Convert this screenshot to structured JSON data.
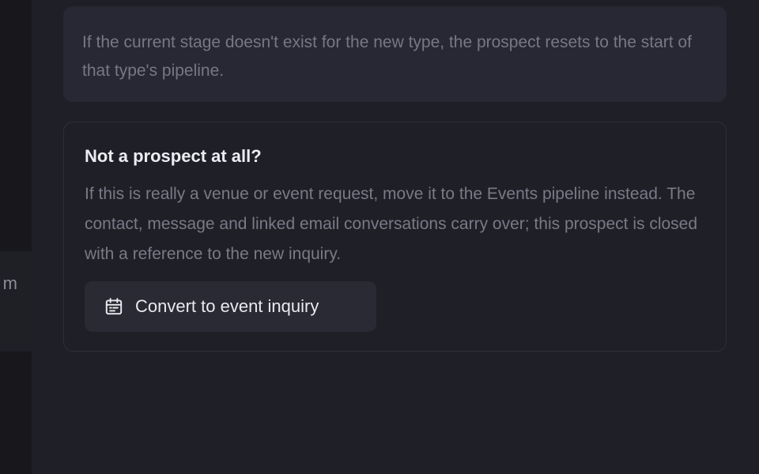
{
  "left_panel": {
    "row_text_fragment": "m"
  },
  "info_box": {
    "text": "If the current stage doesn't exist for the new type, the prospect resets to the start of that type's pipeline."
  },
  "convert_card": {
    "title": "Not a prospect at all?",
    "body": "If this is really a venue or event request, move it to the Events pipeline instead. The contact, message and linked email conversations carry over; this prospect is closed with a reference to the new inquiry.",
    "button_label": "Convert to event inquiry",
    "button_icon": "calendar-icon"
  }
}
